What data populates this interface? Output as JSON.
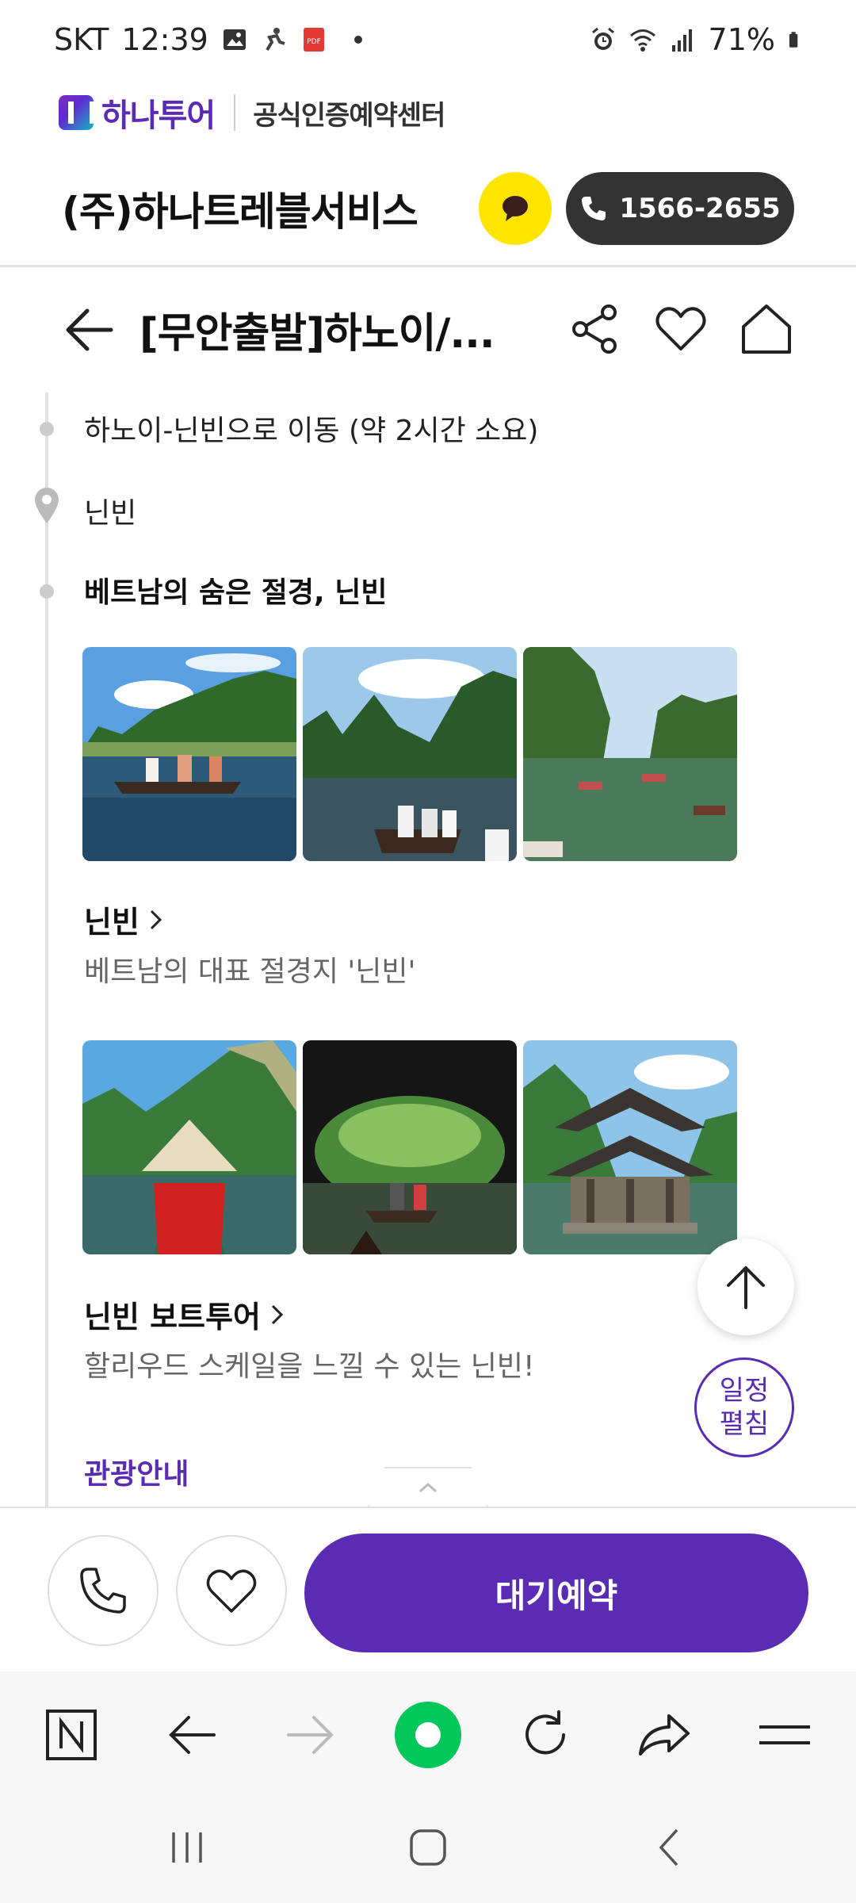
{
  "status_bar": {
    "carrier": "SKT",
    "time": "12:39",
    "battery": "71%",
    "icons": [
      "image-icon",
      "runner-icon",
      "pdf-icon",
      "alarm-icon",
      "wifi-icon",
      "signal-icon",
      "battery-icon"
    ]
  },
  "brand": {
    "logo_text": "하나투어",
    "subtitle": "공식인증예약센터"
  },
  "company": {
    "name": "(주)하나트레블서비스",
    "phone": "1566-2655"
  },
  "title_bar": {
    "title": "[무안출발]하노이/..."
  },
  "timeline": {
    "move_text": "하노이-닌빈으로 이동 (약 2시간 소요)",
    "location": "닌빈",
    "highlight": "베트남의 숨은 절경, 닌빈"
  },
  "places": [
    {
      "title": "닌빈",
      "desc": "베트남의 대표 절경지 '닌빈'"
    },
    {
      "title": "닌빈 보트투어",
      "desc": "할리우드 스케일을 느낄 수 있는 닌빈!"
    }
  ],
  "section_link": "관광안내",
  "floating": {
    "schedule_line1": "일정",
    "schedule_line2": "펼침"
  },
  "action_bar": {
    "reserve_label": "대기예약"
  },
  "colors": {
    "brand_purple": "#5a2bb3",
    "kakao_yellow": "#fee500",
    "pill_dark": "#333333",
    "naver_green": "#03c75a"
  }
}
